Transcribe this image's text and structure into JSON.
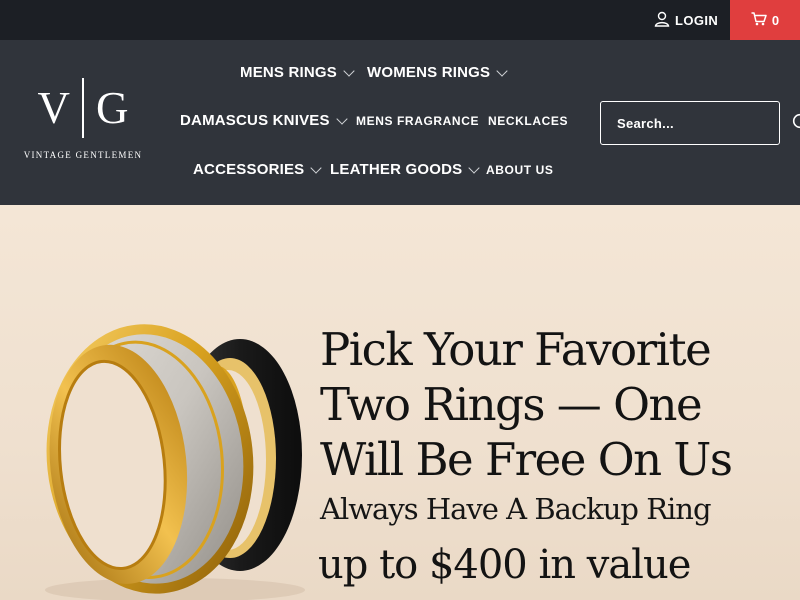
{
  "topbar": {
    "login_label": "LOGIN",
    "cart_count": "0",
    "login_icon": "user-icon",
    "cart_icon": "cart-icon",
    "cart_color": "#e03e3e"
  },
  "logo": {
    "letter_left": "V",
    "letter_right": "G",
    "brand_name": "VINTAGE GENTLEMEN"
  },
  "nav": {
    "mens_rings": "MENS RINGS",
    "womens_rings": "WOMENS RINGS",
    "damascus_knives": "DAMASCUS KNIVES",
    "mens_fragrance": "MENS FRAGRANCE",
    "necklaces": "NECKLACES",
    "accessories": "ACCESSORIES",
    "leather_goods": "LEATHER GOODS",
    "about_us": "ABOUT US"
  },
  "search": {
    "placeholder": "Search...",
    "value": "",
    "icon": "search-icon"
  },
  "hero": {
    "headline_line1": "Pick Your Favorite",
    "headline_line2": "Two Rings — One",
    "headline_line3": "Will Be Free On Us",
    "subheadline": "Always Have A Backup Ring",
    "value_text": "up to $400 in value"
  },
  "colors": {
    "topbar_bg": "#1c1f25",
    "header_bg": "#30343b",
    "hero_bg": "#f0e2d2",
    "ring_gold": "#d9a21f",
    "ring_silver": "#c9c5bf",
    "ring_black": "#1a1a1a"
  }
}
